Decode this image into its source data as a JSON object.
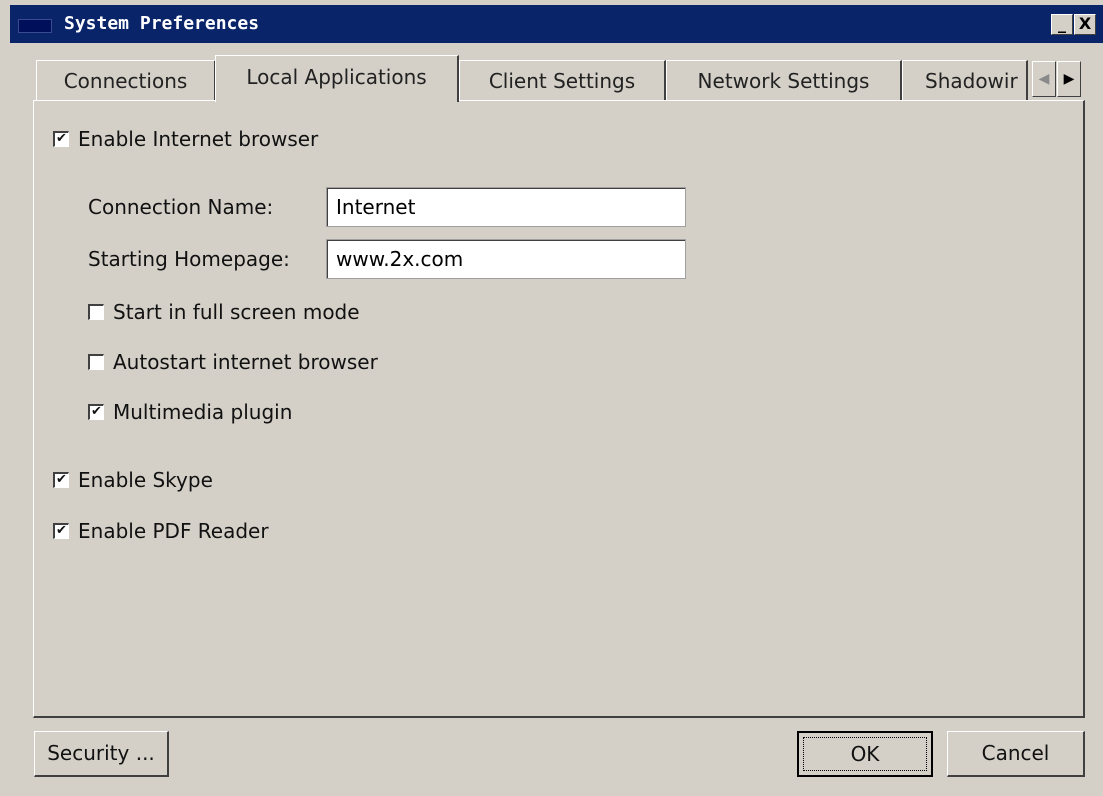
{
  "window": {
    "title": "System Preferences",
    "minimize_label": "_",
    "close_label": "X"
  },
  "tabs": [
    {
      "label": "Connections",
      "active": false
    },
    {
      "label": "Local Applications",
      "active": true
    },
    {
      "label": "Client Settings",
      "active": false
    },
    {
      "label": "Network Settings",
      "active": false
    },
    {
      "label": "Shadowir",
      "active": false
    }
  ],
  "tab_scroll": {
    "left": "◀",
    "right": "▶"
  },
  "internet": {
    "enable_label": "Enable Internet browser",
    "enabled": true,
    "connection_name_label": "Connection Name:",
    "connection_name_value": "Internet",
    "homepage_label": "Starting Homepage:",
    "homepage_value": "www.2x.com",
    "fullscreen_label": "Start in full screen mode",
    "fullscreen": false,
    "autostart_label": "Autostart internet browser",
    "autostart": false,
    "multimedia_label": "Multimedia plugin",
    "multimedia": true
  },
  "skype": {
    "label": "Enable Skype",
    "enabled": true
  },
  "pdf": {
    "label": "Enable PDF Reader",
    "enabled": true
  },
  "buttons": {
    "security": "Security ...",
    "ok": "OK",
    "cancel": "Cancel"
  },
  "colors": {
    "titlebar": "#0a246a",
    "face": "#d4d0c8"
  }
}
